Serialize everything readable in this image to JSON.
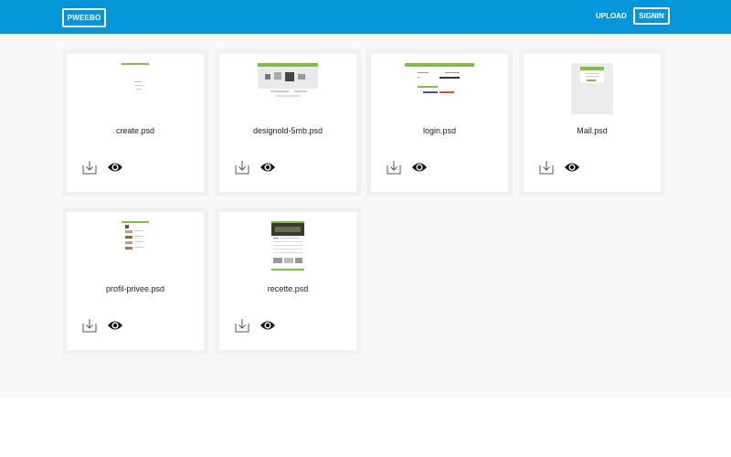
{
  "header": {
    "brand": "PWEEBO",
    "upload_label": "UPLOAD",
    "signin_label": "SIGNIN",
    "bg_color": "#0596d9"
  },
  "files": [
    {
      "name": "create.psd"
    },
    {
      "name": "designold-5mb.psd"
    },
    {
      "name": "login.psd"
    },
    {
      "name": "Mail.psd"
    },
    {
      "name": "profil-privee.psd"
    },
    {
      "name": "recette.psd"
    }
  ],
  "icons": {
    "download": "download-icon",
    "preview": "eye-icon"
  }
}
